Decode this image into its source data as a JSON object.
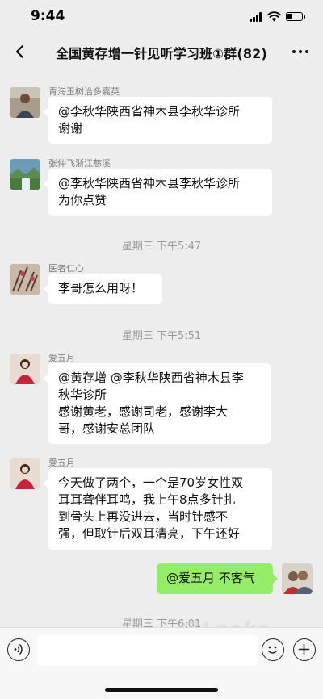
{
  "status": {
    "time": "9:44"
  },
  "header": {
    "title": "全国黄存增一针见听学习班①群(82)"
  },
  "messages": [
    {
      "sender": "青海玉树治多嘉英",
      "text": "@李秋华陕西省神木县李秋华诊所\n谢谢"
    },
    {
      "sender": "张仲飞浙江慈溪",
      "text": "@李秋华陕西省神木县李秋华诊所\n为你点赞"
    },
    {
      "sender": "医者仁心",
      "text": "李哥怎么用呀！"
    },
    {
      "sender": "爱五月",
      "text": "@黄存增 @李秋华陕西省神木县李\n秋华诊所\n感谢黄老，感谢司老，感谢李大\n哥，感谢安总团队"
    },
    {
      "sender": "爱五月",
      "text": "今天做了两个，一个是70岁女性双\n耳耳聋伴耳鸣，我上午8点多针扎\n到骨头上再没进去，当时针感不\n强，但取针后双耳清亮，下午还好"
    },
    {
      "sender": "",
      "text": "@爱五月 不客气"
    }
  ],
  "timestamps": [
    "星期三 下午5:47",
    "星期三 下午5:51",
    "星期三 下午6:01"
  ],
  "watermark": {
    "logo": "Laoke",
    "sub": ".com 老客"
  },
  "colors": {
    "background": "#ededed",
    "self_bubble": "#95ec69",
    "other_bubble": "#ffffff"
  }
}
